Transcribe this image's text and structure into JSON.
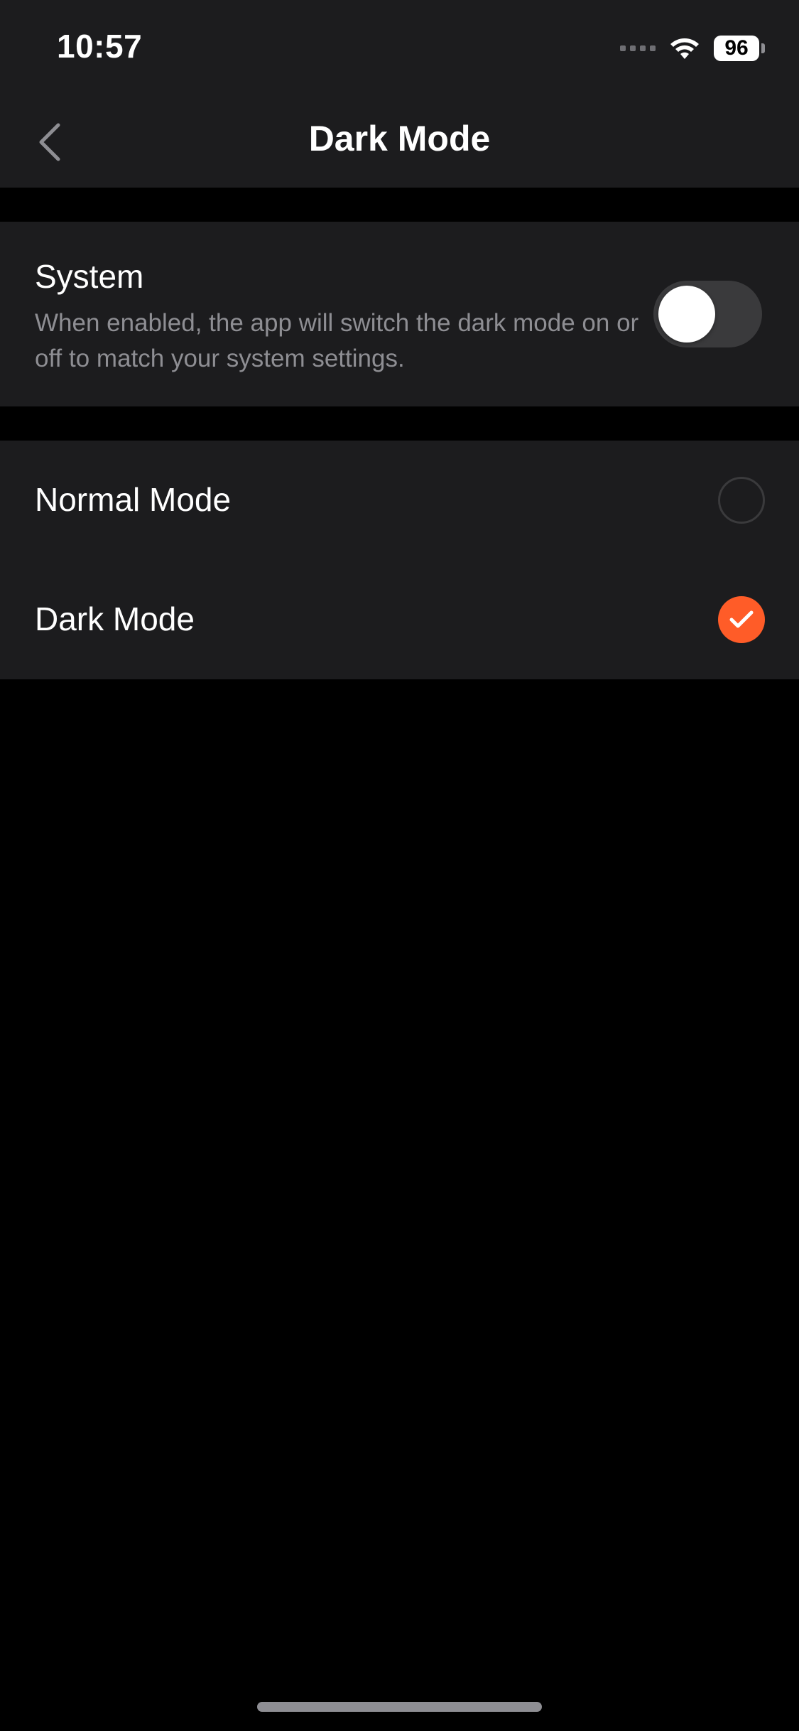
{
  "status_bar": {
    "time": "10:57",
    "battery": "96"
  },
  "nav": {
    "title": "Dark Mode"
  },
  "system": {
    "title": "System",
    "description": "When enabled, the app will switch the dark mode on or off to match your system settings.",
    "enabled": false
  },
  "modes": [
    {
      "label": "Normal Mode",
      "selected": false
    },
    {
      "label": "Dark Mode",
      "selected": true
    }
  ],
  "colors": {
    "accent": "#ff5c28",
    "background": "#000000",
    "surface": "#1c1c1e",
    "secondary_text": "#8e8e93"
  },
  "icons": {
    "back": "chevron-left-icon",
    "wifi": "wifi-icon",
    "signal": "signal-icon",
    "battery": "battery-icon",
    "checkmark": "checkmark-icon"
  }
}
